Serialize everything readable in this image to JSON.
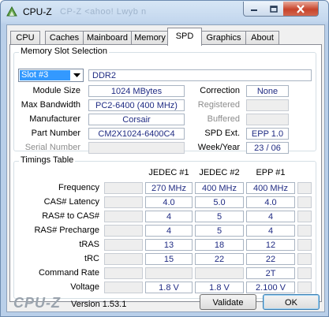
{
  "window": {
    "title": "CPU-Z",
    "ghost_title": "CP-Z  <ahoo!  Lwyb  n",
    "controls": {
      "minimize": "minimize",
      "maximize": "maximize",
      "close": "close"
    }
  },
  "tabs": [
    {
      "label": "CPU"
    },
    {
      "label": "Caches"
    },
    {
      "label": "Mainboard"
    },
    {
      "label": "Memory"
    },
    {
      "label": "SPD",
      "active": true
    },
    {
      "label": "Graphics"
    },
    {
      "label": "About"
    }
  ],
  "memory_slot": {
    "group_title": "Memory Slot Selection",
    "slot_selected": "Slot #3",
    "type": "DDR2",
    "module_size_label": "Module Size",
    "module_size": "1024 MBytes",
    "max_bandwidth_label": "Max Bandwidth",
    "max_bandwidth": "PC2-6400 (400 MHz)",
    "manufacturer_label": "Manufacturer",
    "manufacturer": "Corsair",
    "part_number_label": "Part Number",
    "part_number": "CM2X1024-6400C4",
    "serial_number_label": "Serial Number",
    "serial_number": "",
    "correction_label": "Correction",
    "correction": "None",
    "registered_label": "Registered",
    "registered": "",
    "buffered_label": "Buffered",
    "buffered": "",
    "spd_ext_label": "SPD Ext.",
    "spd_ext": "EPP 1.0",
    "week_year_label": "Week/Year",
    "week_year": "23 / 06"
  },
  "timings": {
    "group_title": "Timings Table",
    "columns": [
      "JEDEC #1",
      "JEDEC #2",
      "EPP #1"
    ],
    "rows": [
      {
        "label": "Frequency",
        "values": [
          "270 MHz",
          "400 MHz",
          "400 MHz"
        ]
      },
      {
        "label": "CAS# Latency",
        "values": [
          "4.0",
          "5.0",
          "4.0"
        ]
      },
      {
        "label": "RAS# to CAS#",
        "values": [
          "4",
          "5",
          "4"
        ]
      },
      {
        "label": "RAS# Precharge",
        "values": [
          "4",
          "5",
          "4"
        ]
      },
      {
        "label": "tRAS",
        "values": [
          "13",
          "18",
          "12"
        ]
      },
      {
        "label": "tRC",
        "values": [
          "15",
          "22",
          "22"
        ]
      },
      {
        "label": "Command Rate",
        "values": [
          "",
          "",
          "2T"
        ]
      },
      {
        "label": "Voltage",
        "values": [
          "1.8 V",
          "1.8 V",
          "2.100 V"
        ]
      }
    ]
  },
  "footer": {
    "logo": "CPU-Z",
    "version": "Version 1.53.1",
    "validate_label": "Validate",
    "ok_label": "OK"
  }
}
